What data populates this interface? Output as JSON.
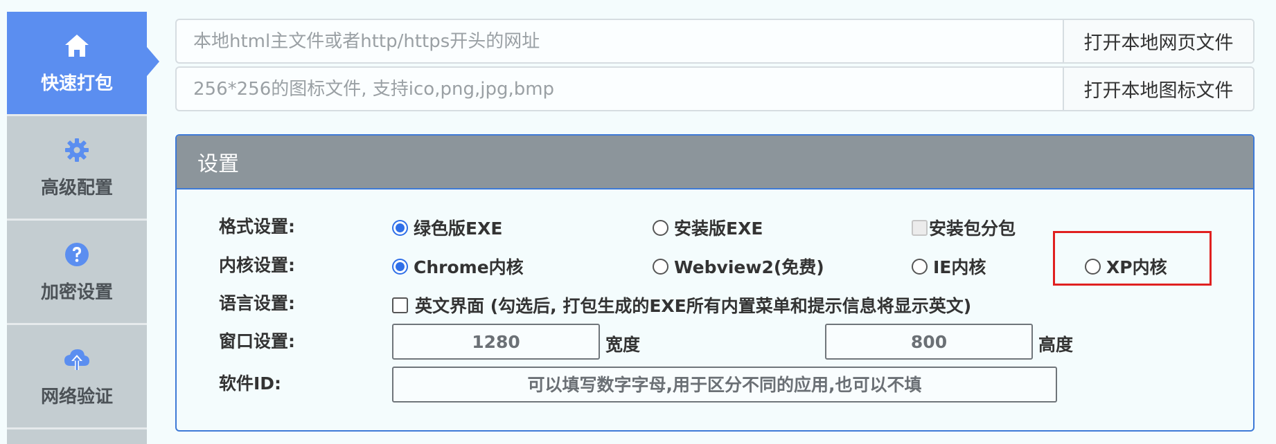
{
  "sidebar": {
    "items": [
      {
        "label": "快速打包",
        "icon": "home-icon",
        "active": true
      },
      {
        "label": "高级配置",
        "icon": "gear-icon",
        "active": false
      },
      {
        "label": "加密设置",
        "icon": "question-circle-icon",
        "active": false
      },
      {
        "label": "网络验证",
        "icon": "cloud-upload-icon",
        "active": false
      }
    ]
  },
  "top": {
    "html_input": {
      "placeholder": "本地html主文件或者http/https开头的网址",
      "button": "打开本地网页文件"
    },
    "icon_input": {
      "placeholder": "256*256的图标文件, 支持ico,png,jpg,bmp",
      "button": "打开本地图标文件"
    }
  },
  "settings": {
    "title": "设置",
    "format": {
      "label": "格式设置:",
      "opt_green": "绿色版EXE",
      "opt_install": "安装版EXE",
      "opt_split": "安装包分包",
      "selected": "绿色版EXE"
    },
    "kernel": {
      "label": "内核设置:",
      "opt_chrome": "Chrome内核",
      "opt_webview2": "Webview2(免费)",
      "opt_ie": "IE内核",
      "opt_xp": "XP内核",
      "selected": "Chrome内核"
    },
    "language": {
      "label": "语言设置:",
      "opt_english": "英文界面 (勾选后, 打包生成的EXE所有内置菜单和提示信息将显示英文)",
      "checked": false
    },
    "window": {
      "label": "窗口设置:",
      "width_value": "1280",
      "width_label": "宽度",
      "height_value": "800",
      "height_label": "高度"
    },
    "software_id": {
      "label": "软件ID:",
      "placeholder": "可以填写数字字母,用于区分不同的应用,也可以不填"
    }
  },
  "colors": {
    "accent": "#5b8ef0",
    "panel_border": "#3d79d6",
    "panel_header": "#8c959b",
    "highlight": "#e02020",
    "radio_on": "#2f6fe8"
  }
}
